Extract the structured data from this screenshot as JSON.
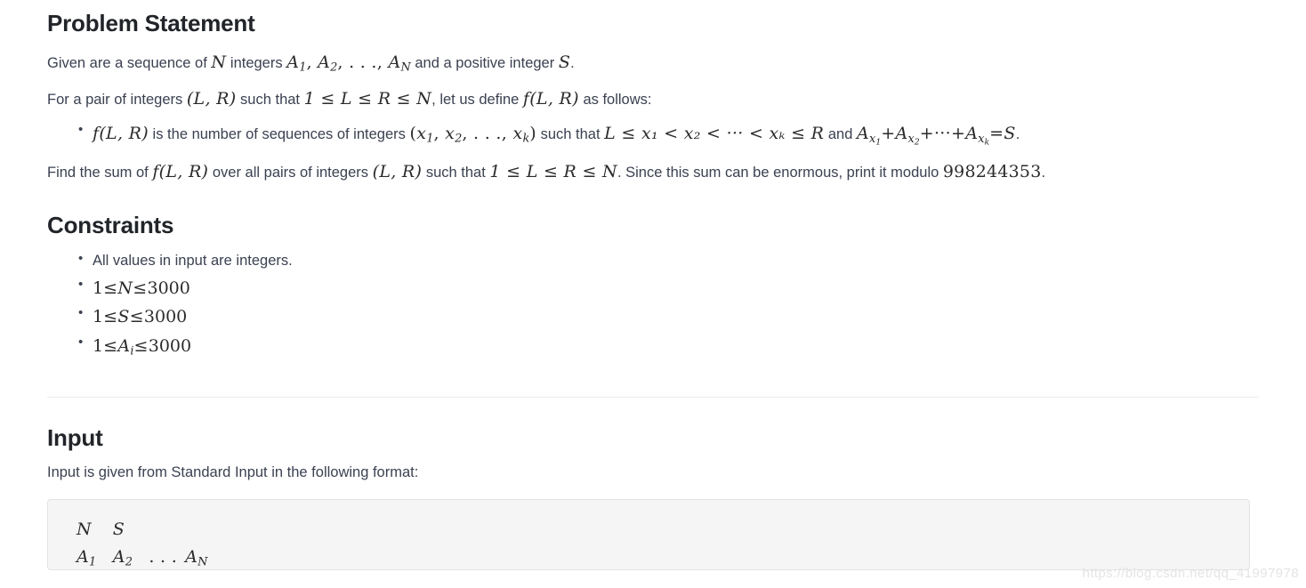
{
  "document": {
    "sections": [
      {
        "id": "problem-statement",
        "title": "Problem Statement"
      },
      {
        "id": "constraints",
        "title": "Constraints"
      },
      {
        "id": "input",
        "title": "Input"
      }
    ]
  },
  "problem_statement": {
    "title": "Problem Statement",
    "para_given": {
      "t1": "Given are a sequence of ",
      "var_n": "N",
      "t2": " integers ",
      "a1": "A",
      "a1_sub": "1",
      "comma1": ", ",
      "a2": "A",
      "a2_sub": "2",
      "comma2": ", ",
      "dots": ". . .",
      "comma3": ", ",
      "an": "A",
      "an_sub": "N",
      "t3": " and a positive integer ",
      "var_s": "S",
      "t4": "."
    },
    "para_pair": {
      "t1": "For a pair of integers ",
      "lr": "(L, R)",
      "t2": " such that ",
      "ineq": "1 ≤ L ≤ R ≤ N",
      "t3": ", let us define ",
      "flr": "f(L, R)",
      "t4": " as follows:"
    },
    "bullet": {
      "flr": "f(L, R)",
      "t1": " is the number of sequences of integers ",
      "xs_open": "(",
      "x1": "x",
      "x1_sub": "1",
      "xs_c1": ", ",
      "x2": "x",
      "x2_sub": "2",
      "xs_c2": ", ",
      "xs_dots": ". . .",
      "xs_c3": ", ",
      "xk": "x",
      "xk_sub": "k",
      "xs_close": ")",
      "t2": " such that ",
      "chain": "L ≤ x₁ < x₂ < ··· < xₖ ≤ R",
      "t3": " and ",
      "ax1": "A",
      "ax1_sub": "x",
      "ax1_sub2": "1",
      "plus1": "+",
      "ax2": "A",
      "ax2_sub": "x",
      "ax2_sub2": "2",
      "plus2": "+",
      "mdots": "···",
      "plus3": "+",
      "axk": "A",
      "axk_sub": "x",
      "axk_sub2": "k",
      "eq": "=",
      "s": "S",
      "t4": "."
    },
    "para_find": {
      "t1": "Find the sum of ",
      "flr": "f(L, R)",
      "t2": " over all pairs of integers ",
      "lr": "(L, R)",
      "t3": " such that ",
      "ineq": "1 ≤ L ≤ R ≤ N",
      "t4": ". Since this sum can be enormous, print it modulo ",
      "modulus": "998244353",
      "t5": "."
    }
  },
  "constraints": {
    "title": "Constraints",
    "items": [
      {
        "kind": "text",
        "text": "All values in input are integers."
      },
      {
        "kind": "math",
        "lhs": "1",
        "op1": "≤",
        "var": "N",
        "sub": "",
        "op2": "≤",
        "rhs": "3000"
      },
      {
        "kind": "math",
        "lhs": "1",
        "op1": "≤",
        "var": "S",
        "sub": "",
        "op2": "≤",
        "rhs": "3000"
      },
      {
        "kind": "math",
        "lhs": "1",
        "op1": "≤",
        "var": "A",
        "sub": "i",
        "op2": "≤",
        "rhs": "3000"
      }
    ]
  },
  "input": {
    "title": "Input",
    "description": "Input is given from Standard Input in the following format:",
    "format": {
      "line1": {
        "n": "N",
        "s": "S"
      },
      "line2": {
        "a1": "A",
        "a1_sub": "1",
        "a2": "A",
        "a2_sub": "2",
        "dots": ". . .",
        "an": "A",
        "an_sub": "N"
      }
    }
  },
  "watermark": {
    "text": "https://blog.csdn.net/qq_41997978"
  },
  "colors": {
    "page_background": "#ffffff",
    "heading": "#212529",
    "body_text": "#3b4151",
    "math_text": "#2b2b2b",
    "divider": "#e9ecef",
    "code_background": "#f5f5f5",
    "code_border": "#e3e3e3",
    "watermark": "#e4e4e4"
  }
}
